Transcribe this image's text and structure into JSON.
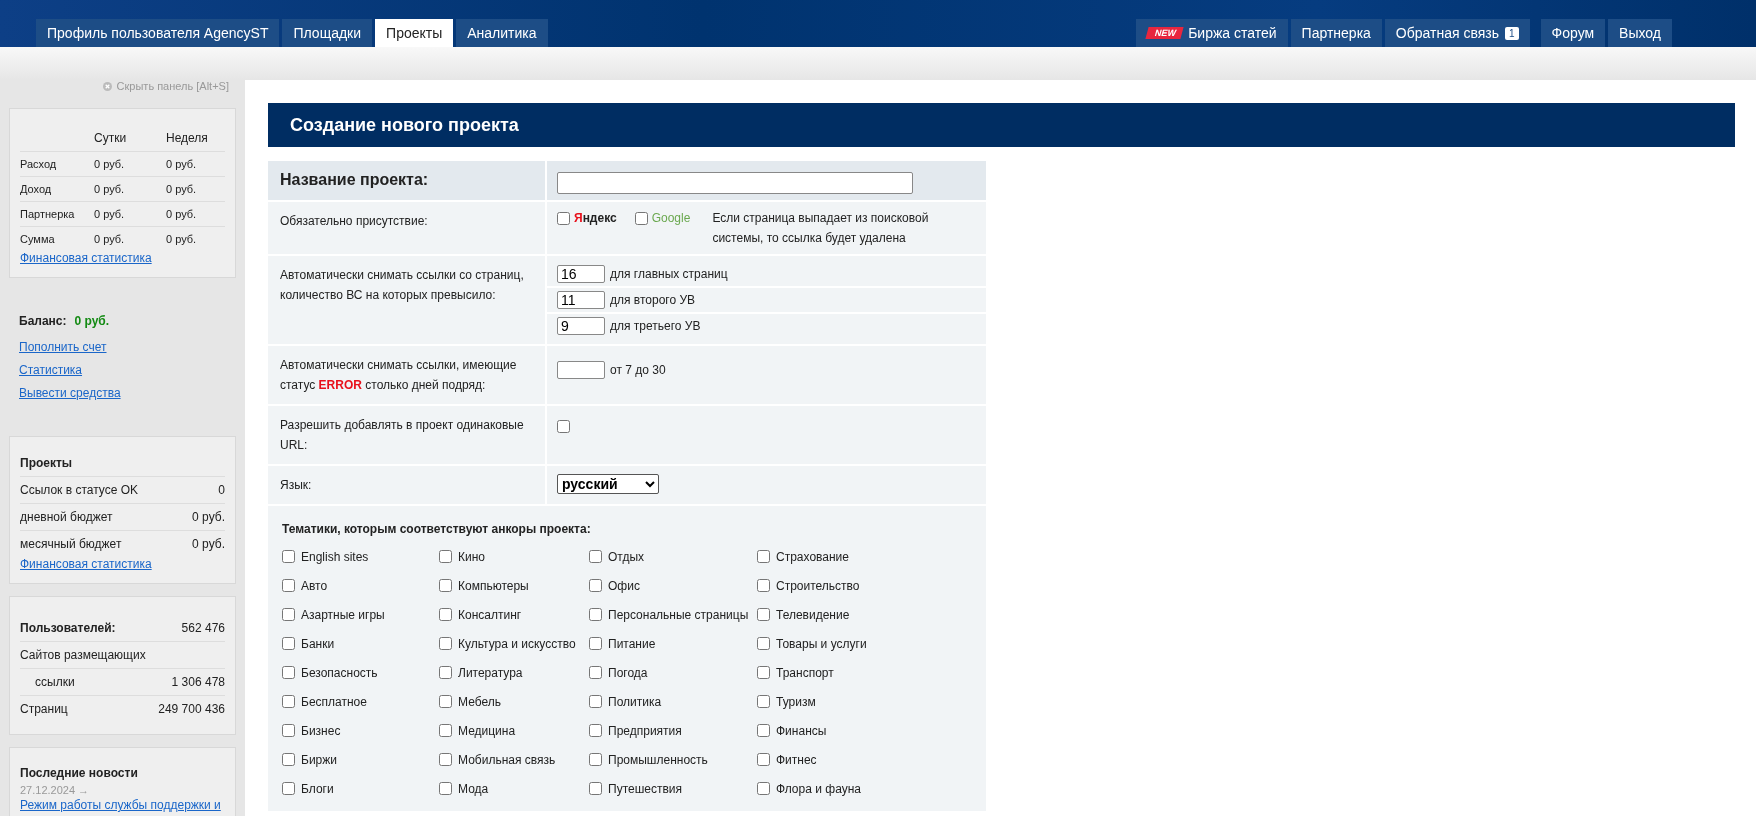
{
  "top_nav": {
    "left_tabs": [
      {
        "label": "Профиль пользователя AgencyST",
        "selected": false
      },
      {
        "label": "Площадки",
        "selected": false
      },
      {
        "label": "Проекты",
        "selected": true
      },
      {
        "label": "Аналитика",
        "selected": false
      }
    ],
    "right_tabs": [
      {
        "label": "Биржа статей",
        "new_badge": "NEW"
      },
      {
        "label": "Партнерка"
      },
      {
        "label": "Обратная связь",
        "count": "1"
      },
      {
        "label": "Форум"
      },
      {
        "label": "Выход"
      }
    ]
  },
  "sidebar": {
    "hide_panel": "Скрыть панель [Alt+S]",
    "finance": {
      "columns": [
        "Сутки",
        "Неделя"
      ],
      "rows": [
        {
          "label": "Расход",
          "day": "0 руб.",
          "week": "0 руб."
        },
        {
          "label": "Доход",
          "day": "0 руб.",
          "week": "0 руб."
        },
        {
          "label": "Партнерка",
          "day": "0 руб.",
          "week": "0 руб."
        },
        {
          "label": "Сумма",
          "day": "0 руб.",
          "week": "0 руб."
        }
      ],
      "link": "Финансовая статистика"
    },
    "balance": {
      "label": "Баланс:",
      "value": "0 руб.",
      "links": [
        "Пополнить счет",
        "Статистика",
        "Вывести средства"
      ]
    },
    "projects": {
      "title": "Проекты",
      "rows": [
        {
          "label": "Ссылок в статусе OK",
          "value": "0"
        },
        {
          "label": "дневной бюджет",
          "value": "0 руб."
        },
        {
          "label": "месячный бюджет",
          "value": "0 руб."
        }
      ],
      "link": "Финансовая статистика"
    },
    "stats": {
      "rows": [
        {
          "kind": "heading",
          "label": "Пользователей:",
          "value": "562 476"
        },
        {
          "kind": "plain",
          "label": "Сайтов размещающих"
        },
        {
          "kind": "indent",
          "label": "ссылки",
          "value": "1 306 478"
        },
        {
          "kind": "plain",
          "label": "Страниц",
          "value": "249 700 436"
        }
      ]
    },
    "news": {
      "title": "Последние новости",
      "date": "27.12.2024 →",
      "link": "Режим работы службы поддержки и"
    }
  },
  "main": {
    "title": "Создание нового проекта",
    "form": [
      {
        "kind": "name",
        "label": "Название проекта:"
      },
      {
        "kind": "engines",
        "label": "Обязательно присутствие:",
        "engines": [
          {
            "kind": "yandex",
            "label": "Яндекс",
            "checked": false
          },
          {
            "kind": "google",
            "label": "Google",
            "checked": false
          }
        ],
        "note": "Если страница выпадает из поисковой системы, то ссылка будет удалена"
      },
      {
        "kind": "thresholds",
        "label": "Автоматически снимать ссылки со страниц, количество ВС на которых превысило:",
        "fields": [
          {
            "value": "16",
            "hint": "для главных страниц"
          },
          {
            "value": "11",
            "hint": "для второго УВ"
          },
          {
            "value": "9",
            "hint": "для третьего УВ"
          }
        ]
      },
      {
        "kind": "days",
        "label": "Автоматически снимать ссылки, имеющие статус **ERROR** столько дней подряд:",
        "hint": "от 7 до 30"
      },
      {
        "kind": "checkbox",
        "label": "Разрешить добавлять в проект одинаковые URL:",
        "checked": false
      },
      {
        "kind": "select",
        "label": "Язык:",
        "value": "русский"
      }
    ],
    "topics": {
      "title": "Тематики, которым соответствуют анкоры проекта:",
      "columns": [
        [
          {
            "label": "English sites",
            "checked": false
          },
          {
            "label": "Авто",
            "checked": false
          },
          {
            "label": "Азартные игры",
            "checked": false
          },
          {
            "label": "Банки",
            "checked": false
          },
          {
            "label": "Безопасность",
            "checked": false
          },
          {
            "label": "Бесплатное",
            "checked": false
          },
          {
            "label": "Бизнес",
            "checked": false
          },
          {
            "label": "Биржи",
            "checked": false
          },
          {
            "label": "Блоги",
            "checked": false
          }
        ],
        [
          {
            "label": "Кино",
            "checked": false
          },
          {
            "label": "Компьютеры",
            "checked": false
          },
          {
            "label": "Консалтинг",
            "checked": false
          },
          {
            "label": "Культура и искусство",
            "checked": false
          },
          {
            "label": "Литература",
            "checked": false
          },
          {
            "label": "Мебель",
            "checked": false
          },
          {
            "label": "Медицина",
            "checked": false
          },
          {
            "label": "Мобильная связь",
            "checked": false
          },
          {
            "label": "Мода",
            "checked": false
          }
        ],
        [
          {
            "label": "Отдых",
            "checked": false
          },
          {
            "label": "Офис",
            "checked": false
          },
          {
            "label": "Персональные страницы",
            "checked": false
          },
          {
            "label": "Питание",
            "checked": false
          },
          {
            "label": "Погода",
            "checked": false
          },
          {
            "label": "Политика",
            "checked": false
          },
          {
            "label": "Предприятия",
            "checked": false
          },
          {
            "label": "Промышленность",
            "checked": false
          },
          {
            "label": "Путешествия",
            "checked": false
          }
        ],
        [
          {
            "label": "Страхование",
            "checked": false
          },
          {
            "label": "Строительство",
            "checked": false
          },
          {
            "label": "Телевидение",
            "checked": false
          },
          {
            "label": "Товары и услуги",
            "checked": false
          },
          {
            "label": "Транспорт",
            "checked": false
          },
          {
            "label": "Туризм",
            "checked": false
          },
          {
            "label": "Финансы",
            "checked": false
          },
          {
            "label": "Фитнес",
            "checked": false
          },
          {
            "label": "Флора и фауна",
            "checked": false
          }
        ]
      ]
    }
  }
}
